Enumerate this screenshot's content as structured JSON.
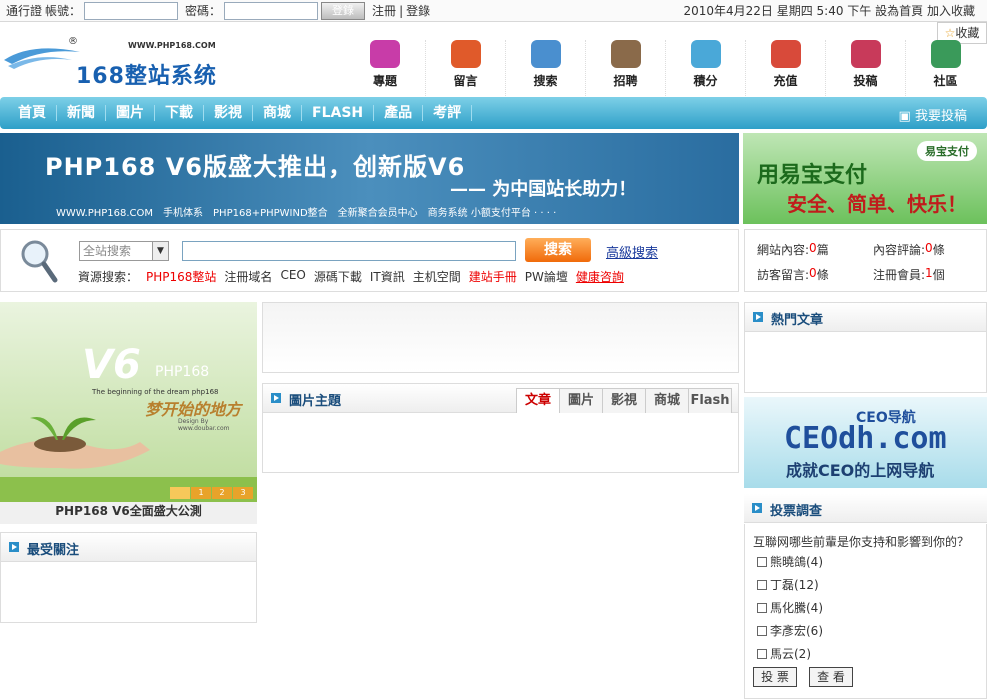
{
  "topbar": {
    "pass_label": "通行證",
    "account_label": "帳號：",
    "password_label": "密碼：",
    "login_button": "登錄",
    "register": "注冊",
    "login": "登錄",
    "datetime": "2010年4月22日 星期四 5:40 下午",
    "set_home": "設為首頁",
    "add_fav": "加入收藏",
    "fav_box": "收藏"
  },
  "logo": {
    "text": "168整站系统",
    "url": "WWW.PHP168.COM",
    "mark": "®"
  },
  "nav_icons": [
    {
      "label": "專題",
      "icon": "blocks-icon",
      "color": "#c83ca8"
    },
    {
      "label": "留言",
      "icon": "cup-icon",
      "color": "#e05a2a"
    },
    {
      "label": "搜索",
      "icon": "magnifier-icon",
      "color": "#4a8fcf"
    },
    {
      "label": "招聘",
      "icon": "person-icon",
      "color": "#8a6a4a"
    },
    {
      "label": "積分",
      "icon": "stars-icon",
      "color": "#4aa8d8"
    },
    {
      "label": "充值",
      "icon": "house-icon",
      "color": "#d84a3a"
    },
    {
      "label": "投稿",
      "icon": "book-icon",
      "color": "#c83a5a"
    },
    {
      "label": "社區",
      "icon": "globe-icon",
      "color": "#3a9a5a"
    }
  ],
  "main_nav": {
    "items": [
      "首頁",
      "新聞",
      "圖片",
      "下載",
      "影視",
      "商城",
      "FLASH",
      "產品",
      "考評"
    ],
    "submit": "我要投稿"
  },
  "banner": {
    "headline": "PHP168 V6版盛大推出，创新版V6",
    "subline": "—— 为中国站长助力！",
    "features": "WWW.PHP168.COM　手机体系　PHP168+PHPWIND整合　全新聚合会员中心　商务系统 小额支付平台 · · · ·"
  },
  "ad_pay": {
    "brand": "易宝支付",
    "line1": "用易宝支付",
    "line2": "安全、简单、快乐！"
  },
  "search": {
    "select_value": "全站搜索",
    "button": "搜索",
    "advanced": "高級搜索",
    "resource_label": "資源搜索：",
    "links": [
      {
        "text": "PHP168整站",
        "style": "red"
      },
      {
        "text": "注冊域名",
        "style": "normal"
      },
      {
        "text": "CEO",
        "style": "normal"
      },
      {
        "text": "源碼下載",
        "style": "normal"
      },
      {
        "text": "IT資訊",
        "style": "normal"
      },
      {
        "text": "主机空間",
        "style": "normal"
      },
      {
        "text": "建站手冊",
        "style": "red"
      },
      {
        "text": "PW論壇",
        "style": "normal"
      },
      {
        "text": "健康咨詢",
        "style": "redul"
      }
    ]
  },
  "stats": {
    "content_label": "網站內容:",
    "content_value": "0",
    "content_unit": "篇",
    "comment_label": "內容評論:",
    "comment_value": "0",
    "comment_unit": "條",
    "guest_label": "訪客留言:",
    "guest_value": "0",
    "guest_unit": "條",
    "member_label": "注冊會員:",
    "member_value": "1",
    "member_unit": "個"
  },
  "slide": {
    "v6": "V6",
    "php": "PHP168",
    "tagline": "The beginning of the dream php168",
    "dream": "梦开始的地方",
    "design": "Design By www.doubar.com",
    "pages": [
      "1",
      "2",
      "3"
    ],
    "caption": "PHP168 V6全面盛大公測"
  },
  "panels": {
    "most_followed": "最受關注",
    "image_topic": "圖片主題",
    "hot_articles": "熱門文章",
    "poll": "投票調查"
  },
  "image_tabs": [
    "文章",
    "圖片",
    "影視",
    "商城",
    "Flash"
  ],
  "ceo_ad": {
    "ceo_small": "CEO导航",
    "main": "CEOdh.com",
    "slogan": "成就CEO的上网导航"
  },
  "poll": {
    "question": "互聯网哪些前輩是你支持和影響到你的？",
    "options": [
      "熊曉鴿(4)",
      "丁磊(12)",
      "馬化騰(4)",
      "李彥宏(6)",
      "馬云(2)"
    ],
    "vote_button": "投 票",
    "view_button": "查 看"
  },
  "colors": {
    "nav": "#2e9fc8",
    "accent": "#f06a0a",
    "red": "#e00000"
  }
}
